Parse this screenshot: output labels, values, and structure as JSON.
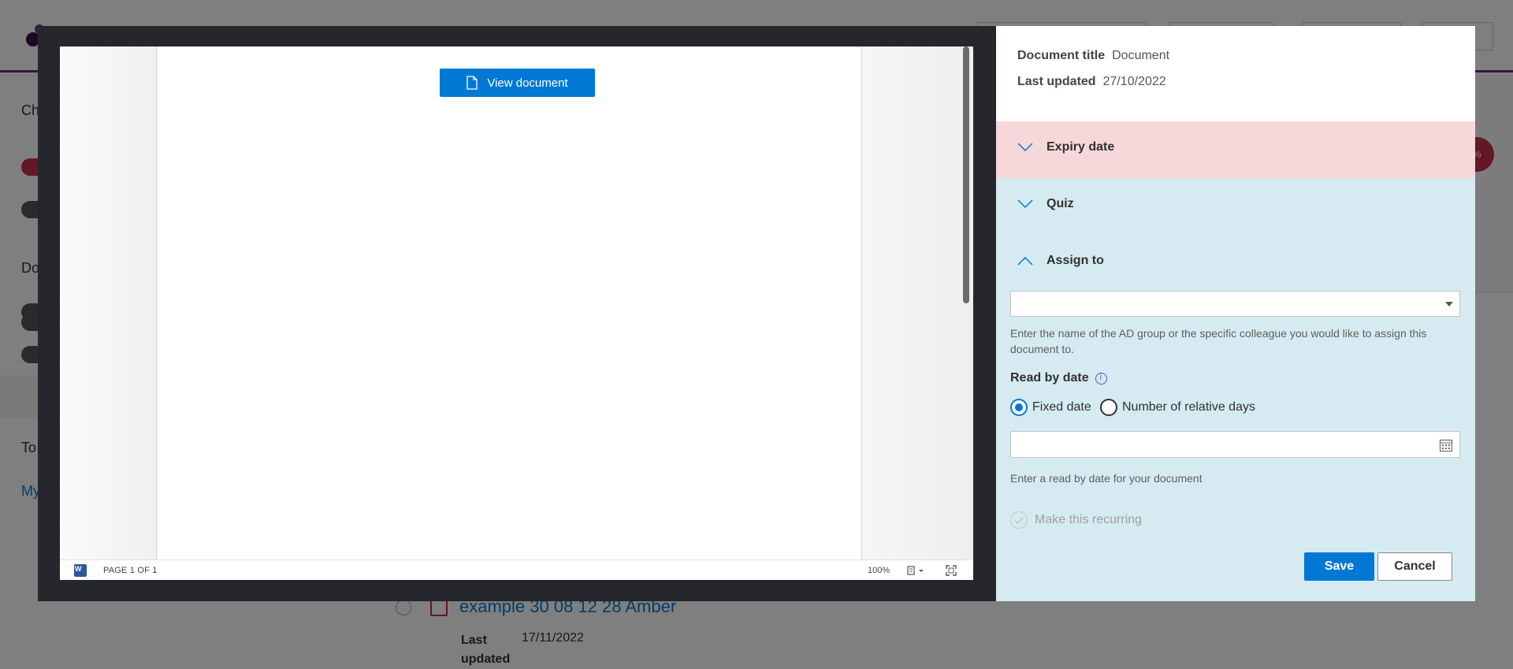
{
  "background": {
    "item": {
      "title": "example 30 08 12 28 Amber",
      "last_updated_label": "Last updated",
      "last_updated_value": "17/11/2022"
    }
  },
  "viewer": {
    "view_document_label": "View document",
    "status_page": "PAGE 1 OF 1",
    "status_zoom": "100%"
  },
  "panel": {
    "document_title_label": "Document title",
    "document_title_value": "Document",
    "last_updated_label": "Last updated",
    "last_updated_value": "27/10/2022",
    "sections": {
      "expiry": "Expiry date",
      "quiz": "Quiz",
      "assign": "Assign to"
    },
    "assign": {
      "combo_value": "",
      "help": "Enter the name of the AD group or the specific colleague you would like to assign this document to."
    },
    "read_by": {
      "label": "Read by date",
      "option_fixed": "Fixed date",
      "option_relative": "Number of relative days",
      "selected": "Fixed date",
      "date_value": "",
      "help": "Enter a read by date for your document"
    },
    "recurring_label": "Make this recurring",
    "save_label": "Save",
    "cancel_label": "Cancel"
  },
  "colors": {
    "accent": "#0078d4",
    "expiry_bg": "#f6d8db",
    "panel_bg": "#d5ebf1",
    "viewer_frame": "#25272c"
  }
}
